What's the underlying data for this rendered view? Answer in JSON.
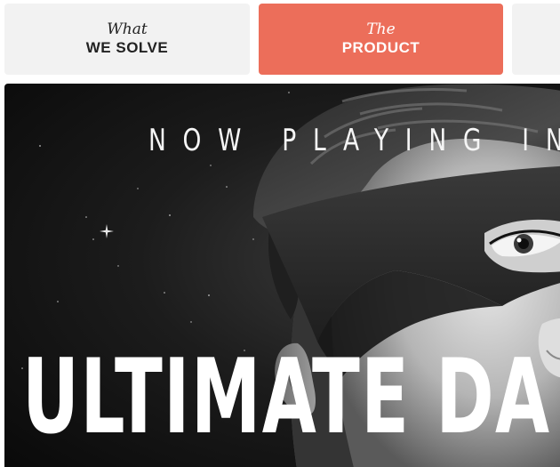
{
  "nav": {
    "tabs": [
      {
        "script": "What",
        "label": "WE SOLVE",
        "active": false
      },
      {
        "script": "The",
        "label": "PRODUCT",
        "active": true
      }
    ],
    "active_color": "#ec6e5a",
    "inactive_color": "#f2f2f2"
  },
  "hero": {
    "tagline": "NOW PLAYING IN",
    "title": "ULTIMATE DA"
  }
}
